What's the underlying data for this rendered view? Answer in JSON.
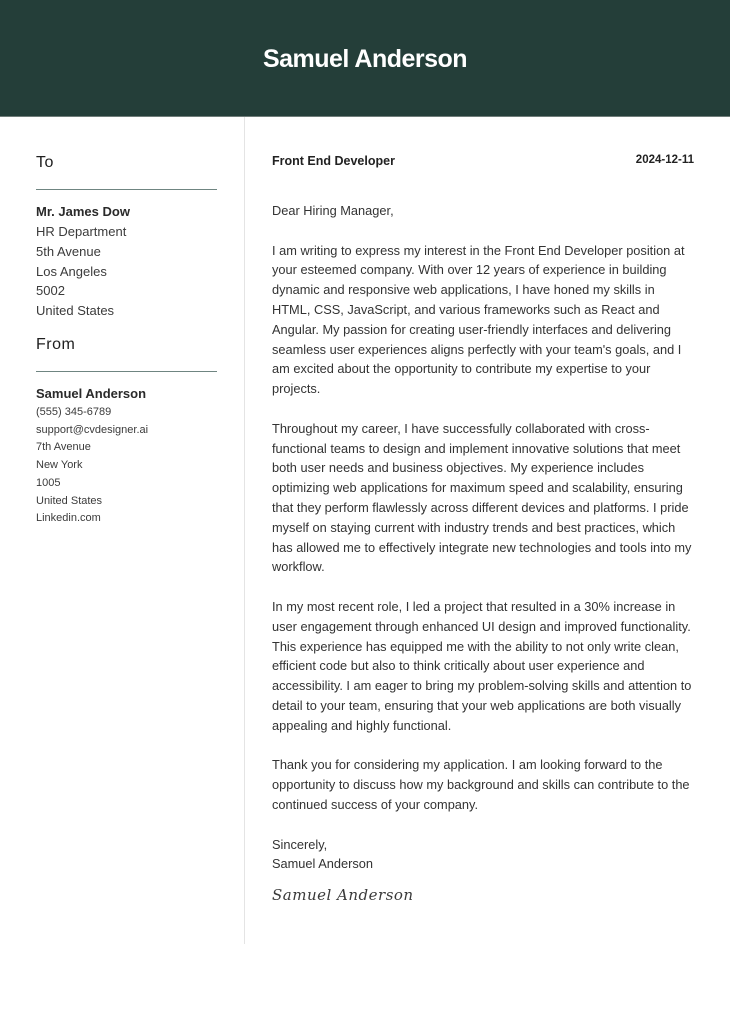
{
  "header": {
    "name": "Samuel Anderson",
    "background_color": "#243e39"
  },
  "sidebar": {
    "to": {
      "title": "To",
      "name": "Mr. James Dow",
      "lines": [
        "HR Department",
        "5th Avenue",
        "Los Angeles",
        "5002",
        "United States"
      ]
    },
    "from": {
      "title": "From",
      "name": "Samuel Anderson",
      "lines": [
        "(555) 345-6789",
        "support@cvdesigner.ai",
        "7th Avenue",
        "New York",
        "1005",
        "United States",
        "Linkedin.com"
      ]
    }
  },
  "letter": {
    "position": "Front End Developer",
    "date": "2024-12-11",
    "salutation": "Dear Hiring Manager,",
    "paragraphs": [
      "I am writing to express my interest in the Front End Developer position at your esteemed company. With over 12 years of experience in building dynamic and responsive web applications, I have honed my skills in HTML, CSS, JavaScript, and various frameworks such as React and Angular. My passion for creating user-friendly interfaces and delivering seamless user experiences aligns perfectly with your team's goals, and I am excited about the opportunity to contribute my expertise to your projects.",
      "Throughout my career, I have successfully collaborated with cross-functional teams to design and implement innovative solutions that meet both user needs and business objectives. My experience includes optimizing web applications for maximum speed and scalability, ensuring that they perform flawlessly across different devices and platforms. I pride myself on staying current with industry trends and best practices, which has allowed me to effectively integrate new technologies and tools into my workflow.",
      "In my most recent role, I led a project that resulted in a 30% increase in user engagement through enhanced UI design and improved functionality. This experience has equipped me with the ability to not only write clean, efficient code but also to think critically about user experience and accessibility. I am eager to bring my problem-solving skills and attention to detail to your team, ensuring that your web applications are both visually appealing and highly functional.",
      "Thank you for considering my application. I am looking forward to the opportunity to discuss how my background and skills can contribute to the continued success of your company."
    ],
    "closing": "Sincerely,",
    "signer": "Samuel Anderson",
    "signature": "Samuel Anderson"
  }
}
